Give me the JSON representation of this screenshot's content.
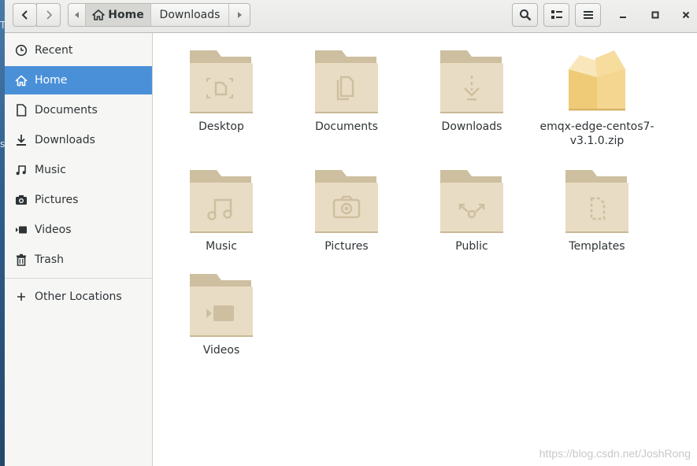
{
  "header": {
    "path_home": "Home",
    "path_current": "Downloads"
  },
  "sidebar": {
    "items": [
      {
        "label": "Recent",
        "icon": "clock-icon"
      },
      {
        "label": "Home",
        "icon": "home-icon",
        "active": true
      },
      {
        "label": "Documents",
        "icon": "document-icon"
      },
      {
        "label": "Downloads",
        "icon": "download-icon"
      },
      {
        "label": "Music",
        "icon": "music-icon"
      },
      {
        "label": "Pictures",
        "icon": "camera-icon"
      },
      {
        "label": "Videos",
        "icon": "video-icon"
      },
      {
        "label": "Trash",
        "icon": "trash-icon"
      }
    ],
    "other_locations": "Other Locations"
  },
  "files": [
    {
      "name": "Desktop",
      "icon": "folder-desktop-icon"
    },
    {
      "name": "Documents",
      "icon": "folder-documents-icon"
    },
    {
      "name": "Downloads",
      "icon": "folder-downloads-icon"
    },
    {
      "name": "emqx-edge-centos7-v3.1.0.zip",
      "icon": "zip-archive-icon"
    },
    {
      "name": "Music",
      "icon": "folder-music-icon"
    },
    {
      "name": "Pictures",
      "icon": "folder-pictures-icon"
    },
    {
      "name": "Public",
      "icon": "folder-public-icon"
    },
    {
      "name": "Templates",
      "icon": "folder-templates-icon"
    },
    {
      "name": "Videos",
      "icon": "folder-videos-icon"
    }
  ],
  "desktop_fragments": [
    "T",
    "s"
  ],
  "watermark": "https://blog.csdn.net/JoshRong",
  "colors": {
    "accent": "#4a90d9",
    "folder": "#e8dcc4",
    "folder_tab": "#cdbf9f",
    "zip": "#f2d38a"
  }
}
